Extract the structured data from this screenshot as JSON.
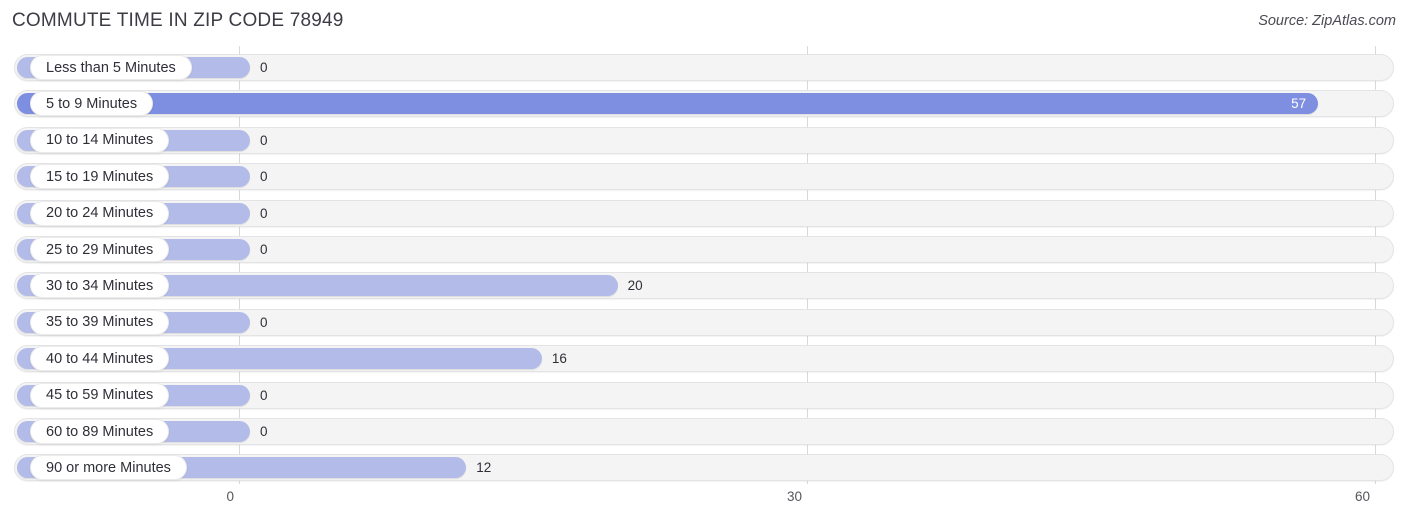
{
  "header": {
    "title": "COMMUTE TIME IN ZIP CODE 78949",
    "source": "Source: ZipAtlas.com"
  },
  "colors": {
    "bar_light": "#b3bce8",
    "bar_strong": "#7e8ee0",
    "track": "#f4f4f5",
    "gridline": "#d8d8d8",
    "text": "#2f2f38"
  },
  "chart_data": {
    "type": "bar",
    "orientation": "horizontal",
    "title": "COMMUTE TIME IN ZIP CODE 78949",
    "xlabel": "",
    "ylabel": "",
    "xlim": [
      0,
      60
    ],
    "xticks": [
      "0",
      "30",
      "60"
    ],
    "grid": true,
    "legend": false,
    "categories": [
      "Less than 5 Minutes",
      "5 to 9 Minutes",
      "10 to 14 Minutes",
      "15 to 19 Minutes",
      "20 to 24 Minutes",
      "25 to 29 Minutes",
      "30 to 34 Minutes",
      "35 to 39 Minutes",
      "40 to 44 Minutes",
      "45 to 59 Minutes",
      "60 to 89 Minutes",
      "90 or more Minutes"
    ],
    "values": [
      0,
      57,
      0,
      0,
      0,
      0,
      20,
      0,
      16,
      0,
      0,
      12
    ],
    "value_labels": [
      "0",
      "57",
      "0",
      "0",
      "0",
      "0",
      "20",
      "0",
      "16",
      "0",
      "0",
      "12"
    ]
  }
}
